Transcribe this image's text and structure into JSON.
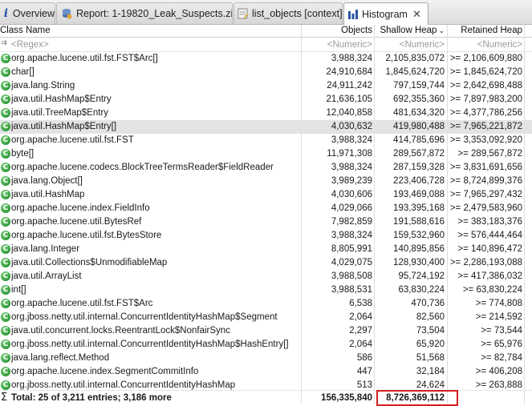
{
  "tabs": [
    {
      "label": "Overview",
      "icon": "info-icon"
    },
    {
      "label": "Report: 1-19820_Leak_Suspects.zip",
      "icon": "report-icon"
    },
    {
      "label": "list_objects [context]",
      "icon": "query-icon"
    },
    {
      "label": "Histogram",
      "icon": "histogram-icon",
      "close": "✕"
    }
  ],
  "columns": {
    "class_name": "Class Name",
    "objects": "Objects",
    "shallow_heap": "Shallow Heap",
    "retained_heap": "Retained Heap"
  },
  "filter": {
    "regex": "<Regex>",
    "numeric1": "<Numeric>",
    "numeric2": "<Numeric>",
    "numeric3": "<Numeric>"
  },
  "rows": [
    {
      "name": "org.apache.lucene.util.fst.FST$Arc[]",
      "objects": "3,988,324",
      "shallow": "2,105,835,072",
      "retained": ">= 2,106,609,880"
    },
    {
      "name": "char[]",
      "objects": "24,910,684",
      "shallow": "1,845,624,720",
      "retained": ">= 1,845,624,720"
    },
    {
      "name": "java.lang.String",
      "objects": "24,911,242",
      "shallow": "797,159,744",
      "retained": ">= 2,642,698,488"
    },
    {
      "name": "java.util.HashMap$Entry",
      "objects": "21,636,105",
      "shallow": "692,355,360",
      "retained": ">= 7,897,983,200"
    },
    {
      "name": "java.util.TreeMap$Entry",
      "objects": "12,040,858",
      "shallow": "481,634,320",
      "retained": ">= 4,377,786,256"
    },
    {
      "name": "java.util.HashMap$Entry[]",
      "objects": "4,030,632",
      "shallow": "419,980,488",
      "retained": ">= 7,965,221,872"
    },
    {
      "name": "org.apache.lucene.util.fst.FST",
      "objects": "3,988,324",
      "shallow": "414,785,696",
      "retained": ">= 3,353,092,920"
    },
    {
      "name": "byte[]",
      "objects": "11,971,308",
      "shallow": "289,567,872",
      "retained": ">= 289,567,872"
    },
    {
      "name": "org.apache.lucene.codecs.BlockTreeTermsReader$FieldReader",
      "objects": "3,988,324",
      "shallow": "287,159,328",
      "retained": ">= 3,831,691,656"
    },
    {
      "name": "java.lang.Object[]",
      "objects": "3,989,239",
      "shallow": "223,406,728",
      "retained": ">= 8,724,899,376"
    },
    {
      "name": "java.util.HashMap",
      "objects": "4,030,606",
      "shallow": "193,469,088",
      "retained": ">= 7,965,297,432"
    },
    {
      "name": "org.apache.lucene.index.FieldInfo",
      "objects": "4,029,066",
      "shallow": "193,395,168",
      "retained": ">= 2,479,583,960"
    },
    {
      "name": "org.apache.lucene.util.BytesRef",
      "objects": "7,982,859",
      "shallow": "191,588,616",
      "retained": ">= 383,183,376"
    },
    {
      "name": "org.apache.lucene.util.fst.BytesStore",
      "objects": "3,988,324",
      "shallow": "159,532,960",
      "retained": ">= 576,444,464"
    },
    {
      "name": "java.lang.Integer",
      "objects": "8,805,991",
      "shallow": "140,895,856",
      "retained": ">= 140,896,472"
    },
    {
      "name": "java.util.Collections$UnmodifiableMap",
      "objects": "4,029,075",
      "shallow": "128,930,400",
      "retained": ">= 2,286,193,088"
    },
    {
      "name": "java.util.ArrayList",
      "objects": "3,988,508",
      "shallow": "95,724,192",
      "retained": ">= 417,386,032"
    },
    {
      "name": "int[]",
      "objects": "3,988,531",
      "shallow": "63,830,224",
      "retained": ">= 63,830,224"
    },
    {
      "name": "org.apache.lucene.util.fst.FST$Arc",
      "objects": "6,538",
      "shallow": "470,736",
      "retained": ">= 774,808"
    },
    {
      "name": "org.jboss.netty.util.internal.ConcurrentIdentityHashMap$Segment",
      "objects": "2,064",
      "shallow": "82,560",
      "retained": ">= 214,592"
    },
    {
      "name": "java.util.concurrent.locks.ReentrantLock$NonfairSync",
      "objects": "2,297",
      "shallow": "73,504",
      "retained": ">= 73,544"
    },
    {
      "name": "org.jboss.netty.util.internal.ConcurrentIdentityHashMap$HashEntry[]",
      "objects": "2,064",
      "shallow": "65,920",
      "retained": ">= 65,976"
    },
    {
      "name": "java.lang.reflect.Method",
      "objects": "586",
      "shallow": "51,568",
      "retained": ">= 82,784"
    },
    {
      "name": "org.apache.lucene.index.SegmentCommitInfo",
      "objects": "447",
      "shallow": "32,184",
      "retained": ">= 406,208"
    },
    {
      "name": "org.jboss.netty.util.internal.ConcurrentIdentityHashMap",
      "objects": "513",
      "shallow": "24,624",
      "retained": ">= 263,888"
    }
  ],
  "selected_row": 5,
  "total": {
    "label": "Total: 25 of 3,211 entries; 3,186 more",
    "objects": "156,335,840",
    "shallow": "8,726,369,112"
  },
  "colors": {
    "class_icon": "#2e9a3a",
    "highlight_box": "#d21f1f",
    "selected_row": "#e3e3e3"
  }
}
